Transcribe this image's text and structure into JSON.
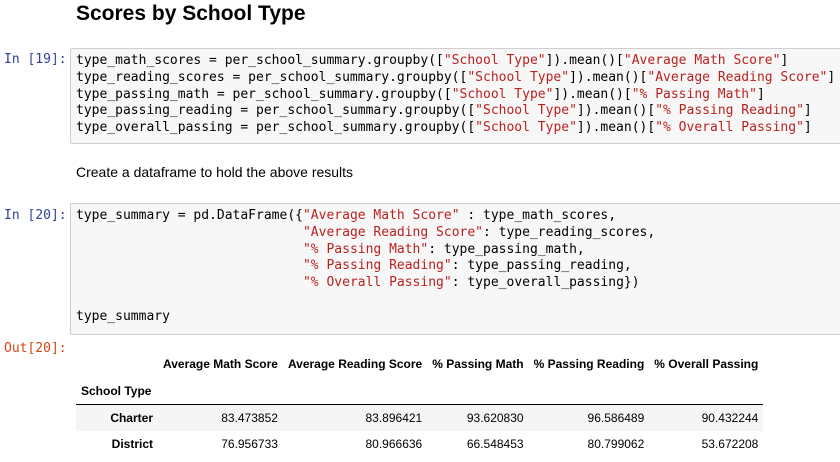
{
  "heading": "Scores by School Type",
  "cells": [
    {
      "prompt": "In [19]:",
      "lines": [
        [
          [
            "type_math_scores = per_school_summary.groupby([",
            ""
          ],
          [
            "\"School Type\"",
            "s"
          ],
          [
            "]).mean()[",
            ""
          ],
          [
            "\"Average Math Score\"",
            "s"
          ],
          [
            "]",
            ""
          ]
        ],
        [
          [
            "type_reading_scores = per_school_summary.groupby([",
            ""
          ],
          [
            "\"School Type\"",
            "s"
          ],
          [
            "]).mean()[",
            ""
          ],
          [
            "\"Average Reading Score\"",
            "s"
          ],
          [
            "]",
            ""
          ]
        ],
        [
          [
            "type_passing_math = per_school_summary.groupby([",
            ""
          ],
          [
            "\"School Type\"",
            "s"
          ],
          [
            "]).mean()[",
            ""
          ],
          [
            "\"% Passing Math\"",
            "s"
          ],
          [
            "]",
            ""
          ]
        ],
        [
          [
            "type_passing_reading = per_school_summary.groupby([",
            ""
          ],
          [
            "\"School Type\"",
            "s"
          ],
          [
            "]).mean()[",
            ""
          ],
          [
            "\"% Passing Reading\"",
            "s"
          ],
          [
            "]",
            ""
          ]
        ],
        [
          [
            "type_overall_passing = per_school_summary.groupby([",
            ""
          ],
          [
            "\"School Type\"",
            "s"
          ],
          [
            "]).mean()[",
            ""
          ],
          [
            "\"% Overall Passing\"",
            "s"
          ],
          [
            "]",
            ""
          ]
        ]
      ]
    },
    {
      "prompt": "In [20]:",
      "lines": [
        [
          [
            "type_summary = pd.DataFrame({",
            ""
          ],
          [
            "\"Average Math Score\"",
            "s"
          ],
          [
            " : type_math_scores,",
            ""
          ]
        ],
        [
          [
            "                             ",
            ""
          ],
          [
            "\"Average Reading Score\"",
            "s"
          ],
          [
            ": type_reading_scores,",
            ""
          ]
        ],
        [
          [
            "                             ",
            ""
          ],
          [
            "\"% Passing Math\"",
            "s"
          ],
          [
            ": type_passing_math,",
            ""
          ]
        ],
        [
          [
            "                             ",
            ""
          ],
          [
            "\"% Passing Reading\"",
            "s"
          ],
          [
            ": type_passing_reading,",
            ""
          ]
        ],
        [
          [
            "                             ",
            ""
          ],
          [
            "\"% Overall Passing\"",
            "s"
          ],
          [
            ": type_overall_passing})",
            ""
          ]
        ],
        [],
        [
          [
            "type_summary",
            ""
          ]
        ]
      ]
    }
  ],
  "markdown_text": "Create a dataframe to hold the above results",
  "output_prompt": "Out[20]:",
  "table": {
    "columns": [
      "Average Math Score",
      "Average Reading Score",
      "% Passing Math",
      "% Passing Reading",
      "% Overall Passing"
    ],
    "index_name": "School Type",
    "rows": [
      {
        "index": "Charter",
        "values": [
          "83.473852",
          "83.896421",
          "93.620830",
          "96.586489",
          "90.432244"
        ]
      },
      {
        "index": "District",
        "values": [
          "76.956733",
          "80.966636",
          "66.548453",
          "80.799062",
          "53.672208"
        ]
      }
    ]
  }
}
